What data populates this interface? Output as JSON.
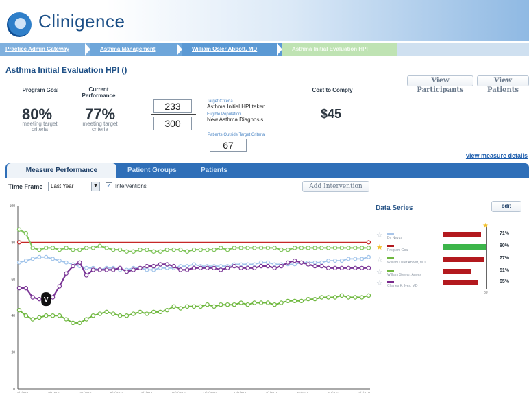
{
  "app": {
    "brand": "Clinigence"
  },
  "breadcrumb": [
    "Practice Admin Gateway",
    "Asthma Management",
    "William Osler Abbott, MD",
    "Asthma Initial Evaluation HPI"
  ],
  "page": {
    "title": "Asthma Initial Evaluation HPI  ()",
    "view_participants": "View Participants",
    "view_patients": "View Patients"
  },
  "summary": {
    "program_goal_label": "Program Goal",
    "program_goal_value": "80%",
    "program_goal_sub": "meeting target criteria",
    "current_perf_label": "Current Performance",
    "current_perf_value": "77%",
    "current_perf_sub": "meeting target criteria",
    "numerator": "233",
    "denominator": "300",
    "target_criteria_label": "Target Criteria",
    "target_criteria_value": "Asthma Initial HPI taken",
    "eligible_population_label": "Eligible Population",
    "eligible_population_value": "New Asthma Diagnosis",
    "outside_label": "Patients Outside Target Criteria",
    "outside_value": "67",
    "cost_label": "Cost to Comply",
    "cost_value": "$45",
    "measure_details_link": "view measure details"
  },
  "tabs": [
    "Measure Performance",
    "Patient Groups",
    "Patients"
  ],
  "controls": {
    "time_frame_label": "Time Frame",
    "time_frame_value": "Last Year",
    "interventions_label": "Interventions",
    "add_intervention": "Add Intervention"
  },
  "data_series": {
    "title": "Data Series",
    "edit": "edit",
    "items": [
      {
        "name": "Dr. Nevus",
        "pct": "71%",
        "value": 71,
        "color": "#a9c6ea",
        "bar_color": "#b3191e",
        "starred": false
      },
      {
        "name": "Program Goal",
        "pct": "80%",
        "value": 80,
        "color": "#b3191e",
        "bar_color": "#3cb54a",
        "starred": true
      },
      {
        "name": "William Osler Abbott, MD",
        "pct": "77%",
        "value": 77,
        "color": "#6fb83f",
        "bar_color": "#b3191e",
        "starred": false
      },
      {
        "name": "William Stewart Agnes",
        "pct": "51%",
        "value": 51,
        "color": "#6fb83f",
        "bar_color": "#b3191e",
        "starred": false
      },
      {
        "name": "Charles K. Ives, MD",
        "pct": "65%",
        "value": 65,
        "color": "#7a2a8c",
        "bar_color": "#b3191e",
        "starred": false
      }
    ],
    "axis_label": "80"
  },
  "chart_data": {
    "type": "line",
    "title": "",
    "xlabel": "",
    "ylabel": "",
    "ylim": [
      0,
      100
    ],
    "yticks": [
      0,
      20,
      40,
      60,
      80,
      100
    ],
    "x_ticks": [
      "5/1/2010",
      "6/1/2010",
      "7/1/2010",
      "8/1/2010",
      "9/1/2010",
      "10/1/2010",
      "11/1/2010",
      "12/1/2010",
      "1/1/2011",
      "2/1/2011",
      "3/1/2011",
      "4/1/2011"
    ],
    "grid": false,
    "colors": {
      "goal": "#c62828",
      "light_green": "#7fc45a",
      "light_blue": "#9fc3ea",
      "purple": "#7a3596",
      "green2": "#6fb83f"
    },
    "series": [
      {
        "values": [
          80,
          80,
          80,
          80,
          80,
          80,
          80,
          80,
          80,
          80,
          80,
          80,
          80,
          80,
          80,
          80,
          80,
          80,
          80,
          80,
          80,
          80,
          80,
          80,
          80,
          80,
          80,
          80,
          80,
          80,
          80,
          80,
          80,
          80,
          80,
          80,
          80,
          80,
          80,
          80,
          80,
          80,
          80,
          80,
          80,
          80,
          80,
          80,
          80,
          80,
          80,
          80,
          80
        ]
      },
      {
        "values": [
          87,
          85,
          77,
          76,
          77,
          77,
          76,
          77,
          76,
          76,
          77,
          77,
          78,
          77,
          76,
          76,
          75,
          75,
          76,
          76,
          75,
          75,
          76,
          76,
          76,
          75,
          76,
          76,
          76,
          76,
          77,
          76,
          77,
          77,
          77,
          77,
          77,
          77,
          77,
          76,
          76,
          77,
          77,
          77,
          77,
          77,
          77,
          77,
          77,
          77,
          77,
          77,
          77
        ]
      },
      {
        "values": [
          69,
          70,
          71,
          72,
          72,
          71,
          70,
          69,
          68,
          67,
          66,
          66,
          65,
          66,
          66,
          65,
          65,
          66,
          66,
          65,
          65,
          66,
          66,
          66,
          67,
          67,
          68,
          67,
          67,
          67,
          67,
          67,
          68,
          68,
          68,
          68,
          69,
          69,
          68,
          68,
          68,
          68,
          69,
          69,
          69,
          69,
          70,
          70,
          70,
          71,
          71,
          71,
          72
        ]
      },
      {
        "values": [
          55,
          55,
          50,
          49,
          49,
          50,
          56,
          63,
          67,
          69,
          62,
          65,
          65,
          65,
          65,
          66,
          64,
          65,
          66,
          67,
          67,
          68,
          68,
          67,
          65,
          65,
          66,
          66,
          66,
          66,
          65,
          66,
          67,
          66,
          66,
          66,
          67,
          67,
          66,
          67,
          69,
          70,
          69,
          68,
          67,
          67,
          66,
          66,
          66,
          66,
          66,
          66,
          66
        ]
      },
      {
        "values": [
          43,
          40,
          38,
          39,
          40,
          40,
          40,
          38,
          36,
          36,
          38,
          40,
          41,
          42,
          41,
          40,
          40,
          41,
          42,
          41,
          42,
          42,
          43,
          45,
          44,
          45,
          45,
          45,
          46,
          45,
          46,
          46,
          46,
          47,
          46,
          47,
          47,
          47,
          46,
          47,
          48,
          48,
          48,
          49,
          49,
          50,
          50,
          50,
          51,
          50,
          50,
          50,
          51
        ]
      }
    ]
  }
}
